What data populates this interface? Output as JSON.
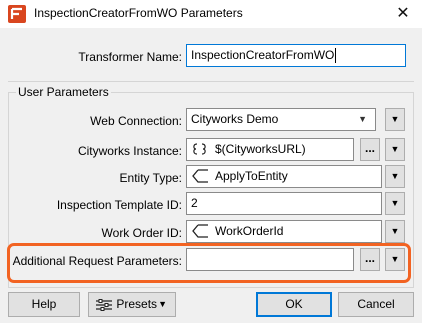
{
  "window": {
    "title": "InspectionCreatorFromWO Parameters",
    "close": "✕"
  },
  "transformer": {
    "label": "Transformer Name:",
    "value": "InspectionCreatorFromWO"
  },
  "group": {
    "title": "User Parameters"
  },
  "params": {
    "web_connection": {
      "label": "Web Connection:",
      "value": "Cityworks Demo"
    },
    "instance": {
      "label": "Cityworks Instance:",
      "value": "$(CityworksURL)"
    },
    "entity_type": {
      "label": "Entity Type:",
      "value": "ApplyToEntity"
    },
    "template_id": {
      "label": "Inspection Template ID:",
      "value": "2"
    },
    "work_order_id": {
      "label": "Work Order ID:",
      "value": "WorkOrderId"
    },
    "additional": {
      "label": "Additional Request Parameters:",
      "value": ""
    }
  },
  "glyphs": {
    "ellipsis": "...",
    "menu_arrow": "▼",
    "combo_arrow": "▼",
    "presets_arrow": "▼"
  },
  "footer": {
    "help": "Help",
    "presets": "Presets",
    "ok": "OK",
    "cancel": "Cancel"
  },
  "colors": {
    "highlight": "#f26322",
    "focus": "#0078d7",
    "app_icon": "#d9461f"
  },
  "icons": {
    "app": "fme-app-icon",
    "instance": "parameter-reference-icon",
    "attribute": "attribute-value-icon",
    "presets": "presets-icon"
  }
}
